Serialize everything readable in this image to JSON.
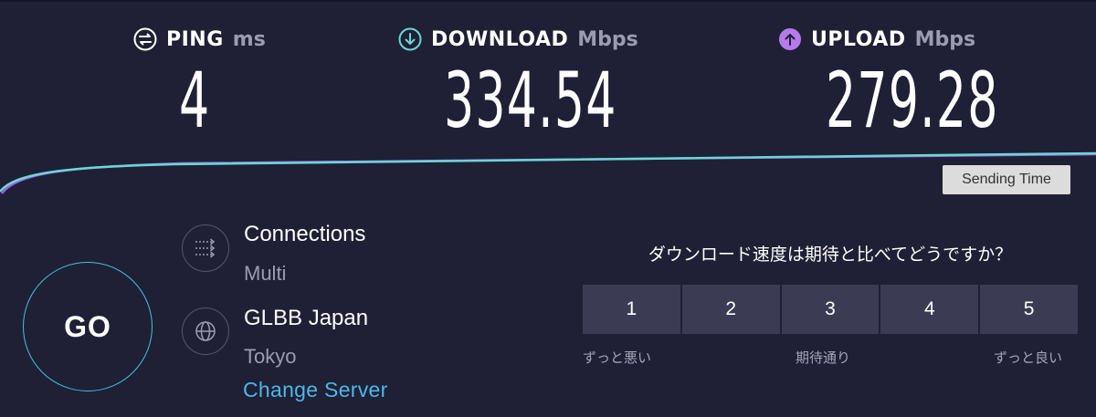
{
  "metrics": {
    "ping": {
      "name": "PING",
      "unit": "ms",
      "value": "4",
      "icon": "ping-icon",
      "color": "#ffffff"
    },
    "download": {
      "name": "DOWNLOAD",
      "unit": "Mbps",
      "value": "334.54",
      "icon": "download-arrow-icon",
      "color": "#6ad7d4"
    },
    "upload": {
      "name": "UPLOAD",
      "unit": "Mbps",
      "value": "279.28",
      "icon": "upload-arrow-icon",
      "color": "#b57bea"
    }
  },
  "graph": {
    "tooltip": "Sending Time",
    "download_color": "#6ad7d4",
    "upload_color": "#a25fe9"
  },
  "go_button": {
    "label": "GO",
    "ring_color": "#40c4d8"
  },
  "connections": {
    "title": "Connections",
    "value": "Multi",
    "icon": "connections-icon"
  },
  "server": {
    "name": "GLBB Japan",
    "location": "Tokyo",
    "change_label": "Change Server",
    "icon": "globe-icon"
  },
  "survey": {
    "question": "ダウンロード速度は期待と比べてどうですか？",
    "options": [
      "1",
      "2",
      "3",
      "4",
      "5"
    ],
    "scale_low": "ずっと悪い",
    "scale_mid": "期待通り",
    "scale_high": "ずっと良い"
  },
  "colors": {
    "background": "#1f2035",
    "accent_link": "#4cb8e6",
    "button_bg": "#3b3c54"
  }
}
